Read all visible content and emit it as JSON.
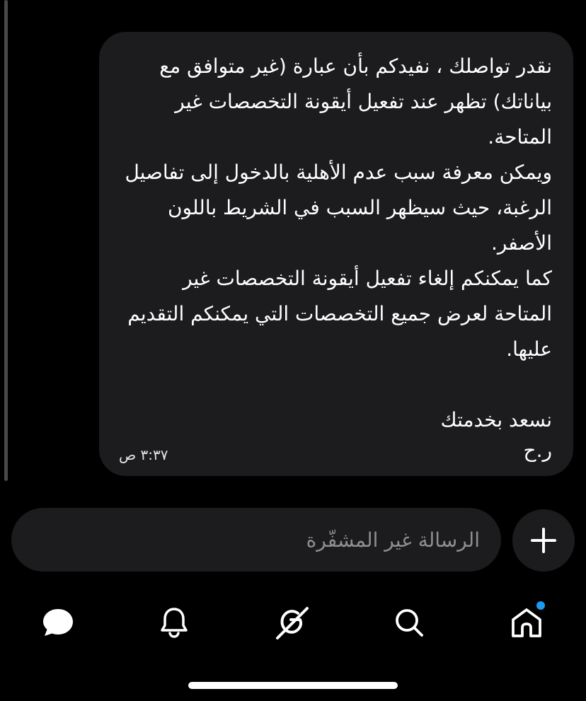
{
  "colors": {
    "background": "#000000",
    "bubble": "#1c1c1e",
    "text": "#ffffff",
    "placeholder": "#8e8e93",
    "notification_dot": "#1d9bf0"
  },
  "message": {
    "text": "نقدر تواصلك ، نفيدكم بأن عبارة (غير متوافق مع بياناتك) تظهر عند تفعيل أيقونة التخصصات غير المتاحة.\nويمكن معرفة سبب عدم الأهلية بالدخول إلى تفاصيل الرغبة، حيث سيظهر السبب في الشريط باللون الأصفر.\nكما يمكنكم إلغاء تفعيل أيقونة التخصصات غير المتاحة لعرض جميع التخصصات التي يمكنكم التقديم عليها.\n\nنسعد بخدمتك",
    "signature": "ر.ح",
    "time": "٣:٣٧ ص"
  },
  "composer": {
    "placeholder": "الرسالة غير المشفّرة",
    "value": "",
    "add_icon": "plus-icon"
  },
  "nav": {
    "items": [
      {
        "name": "messages",
        "icon": "chat-bubble-icon"
      },
      {
        "name": "notifications",
        "icon": "bell-icon"
      },
      {
        "name": "grok",
        "icon": "grok-icon"
      },
      {
        "name": "search",
        "icon": "search-icon"
      },
      {
        "name": "home",
        "icon": "home-icon",
        "has_badge": true
      }
    ]
  }
}
